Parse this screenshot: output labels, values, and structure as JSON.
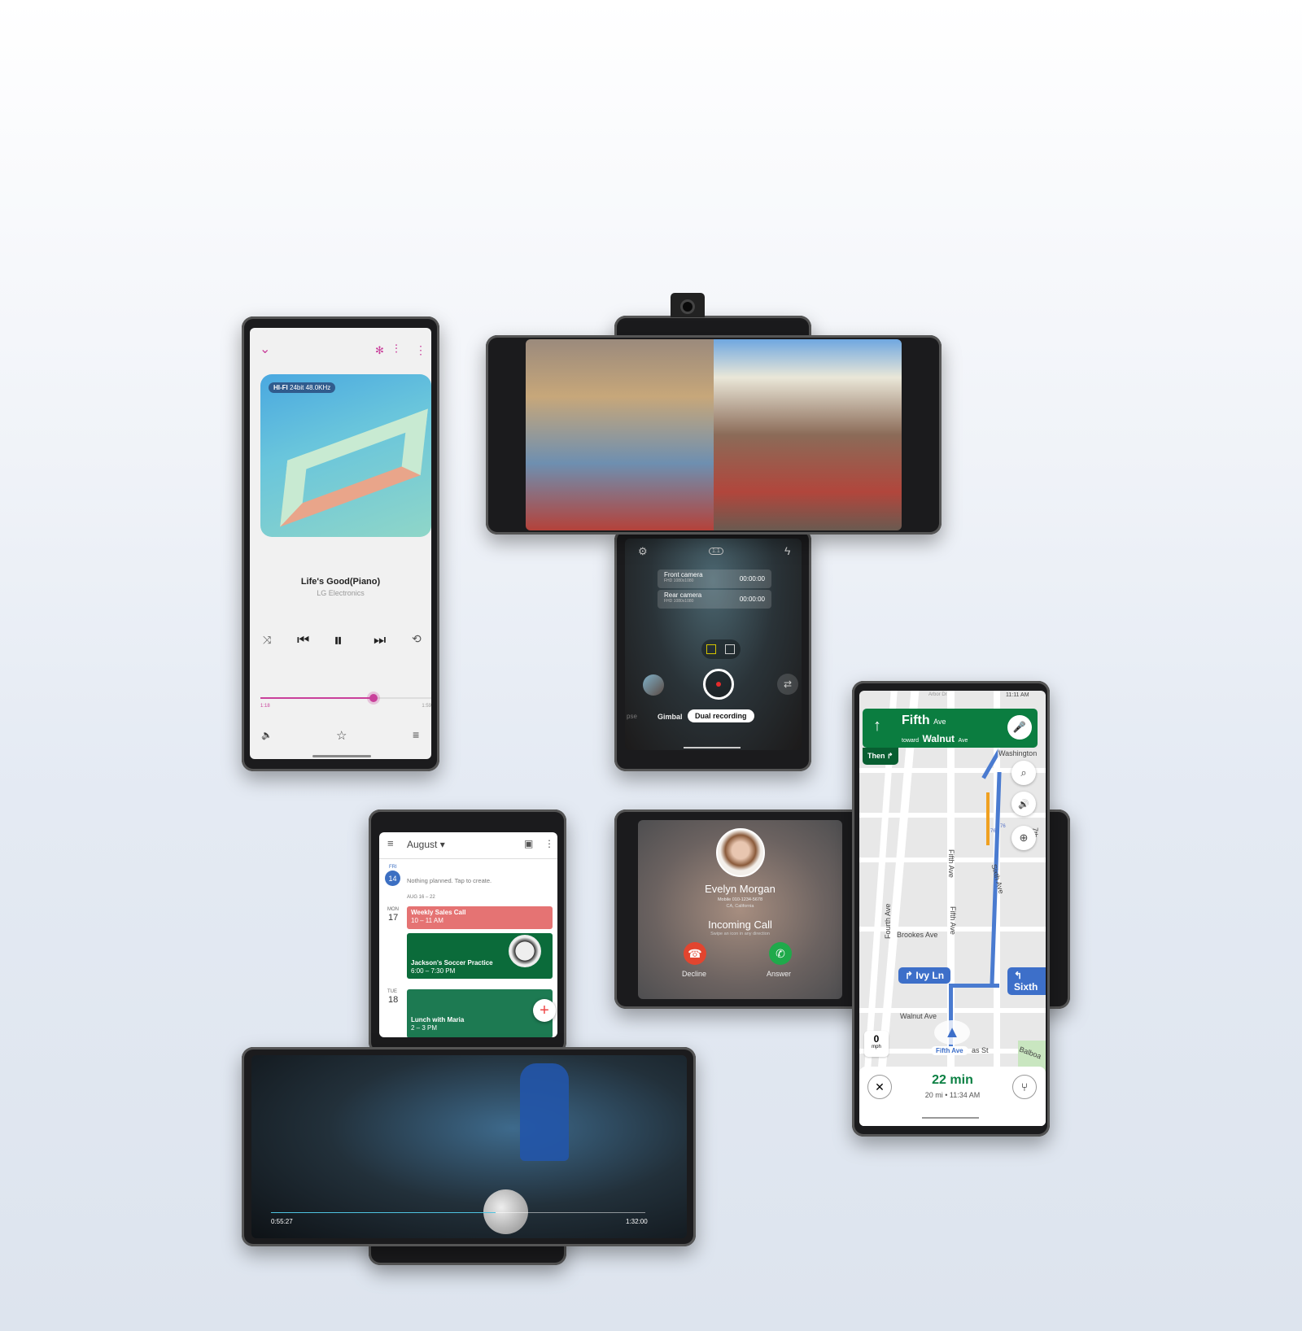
{
  "music": {
    "hifi_badge": "HI-FI",
    "format": "24bit 48.0KHz",
    "title": "Life's Good(Piano)",
    "artist": "LG Electronics",
    "elapsed": "1:18",
    "duration": "1:59",
    "progress": 0.66,
    "accent": "#c9409b",
    "icons": {
      "collapse": "chevron-down-icon",
      "effects": "sparkle-icon",
      "equalizer": "equalizer-icon",
      "more": "more-vert-icon",
      "shuffle": "shuffle-icon",
      "prev": "skip-previous-icon",
      "pause": "pause-icon",
      "next": "skip-next-icon",
      "repeat": "repeat-off-icon",
      "volume": "volume-icon",
      "favorite": "star-icon",
      "playlist": "playlist-icon"
    },
    "glyphs": {
      "collapse": "⌄",
      "effects": "✻",
      "equalizer": "⫶",
      "more": "⋮",
      "shuffle": "⤨",
      "prev": "⏮",
      "pause": "⏸",
      "next": "⏭",
      "repeat": "⟲",
      "volume": "🔈",
      "favorite": "☆",
      "playlist": "≡"
    }
  },
  "camera": {
    "ratio": "1:1",
    "rows": [
      {
        "label": "Front camera",
        "res": "FHD 1080x1080",
        "time": "00:00:00"
      },
      {
        "label": "Rear camera",
        "res": "FHD 1080x1080",
        "time": "00:00:00"
      }
    ],
    "modes": [
      "pse",
      "Gimbal",
      "Dual recording"
    ],
    "active_mode": "Dual recording",
    "record_color": "#e52b2b",
    "glyphs": {
      "settings": "⚙",
      "flash": "ϟ",
      "swap": "⇄"
    }
  },
  "calendar": {
    "month": "August",
    "today": {
      "dow": "FRI",
      "day": "14",
      "note": "Nothing planned. Tap to create."
    },
    "week_range": "AUG 16 – 22",
    "days": [
      {
        "dow": "MON",
        "day": "17"
      },
      {
        "dow": "TUE",
        "day": "18"
      }
    ],
    "events": [
      {
        "title": "Weekly Sales Call",
        "time": "10 – 11 AM",
        "color": "#e57373"
      },
      {
        "title": "Jackson's Soccer Practice",
        "time": "6:00 – 7:30 PM",
        "color": "#0b6b3a"
      },
      {
        "title": "Lunch with Maria",
        "time": "2 – 3 PM",
        "color": "#1d7a52"
      }
    ],
    "glyphs": {
      "menu": "≡",
      "calendar": "▣",
      "more": "⋮",
      "add": "+"
    }
  },
  "call": {
    "name": "Evelyn Morgan",
    "number": "Mobile 010-1234-5678",
    "location": "CA, California",
    "status": "Incoming Call",
    "hint": "Swipe an icon in any direction",
    "decline": "Decline",
    "answer": "Answer",
    "decline_color": "#e2452f",
    "answer_color": "#1faa4b"
  },
  "maps": {
    "time": "11:11 AM",
    "street": "Fifth",
    "street_suffix": "Ave",
    "toward": "toward",
    "toward_street": "Walnut",
    "toward_suffix": "Ave",
    "then": "Then ↱",
    "nav_color": "#0b7d40",
    "labels": [
      "Arbor Dr",
      "Sixth Ave",
      "Washington",
      "Fifth Ave",
      "Fifth Ave",
      "Sixth Ave",
      "Fourth Ave",
      "Brookes Ave",
      "Walnut Ave",
      "7th Ave",
      "as St",
      "Balboa",
      "76",
      "76"
    ],
    "ivy": "↱ Ivy Ln",
    "sixth": "↰ Sixth",
    "current": "Fifth Ave",
    "speed": "0",
    "speed_unit": "mph",
    "eta_min": "22 min",
    "eta_detail": "20 mi • 11:34 AM",
    "glyphs": {
      "up": "↑",
      "mic": "🎤",
      "search": "⌕",
      "sound": "🔊",
      "report": "⊕",
      "close": "✕",
      "routes": "⑂"
    }
  },
  "video": {
    "elapsed": "0:55:27",
    "duration": "1:32:00",
    "progress": 0.6
  }
}
